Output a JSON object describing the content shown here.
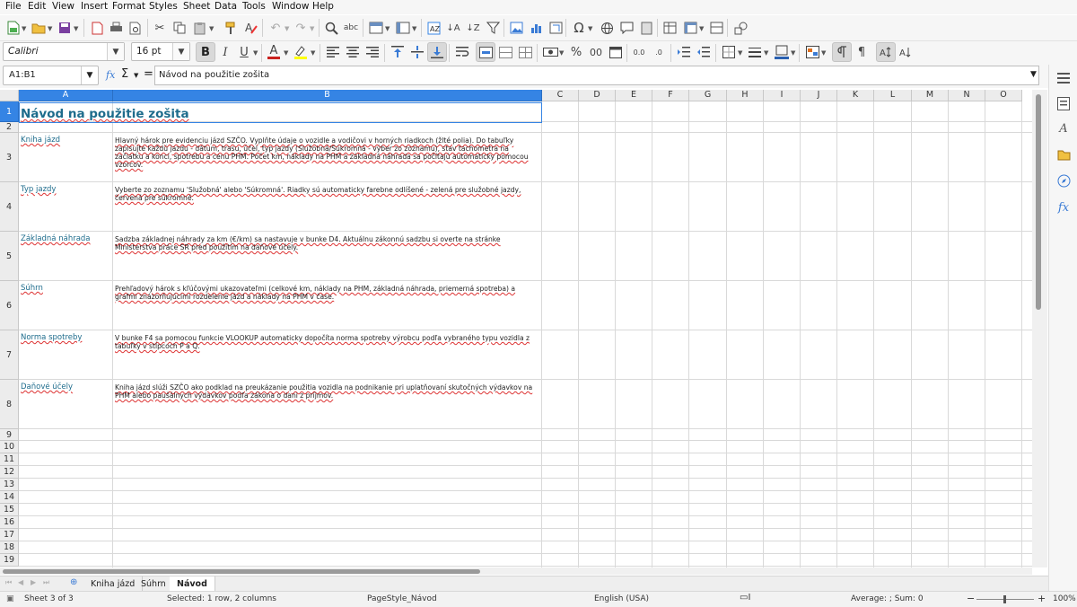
{
  "menu": [
    "File",
    "Edit",
    "View",
    "Insert",
    "Format",
    "Styles",
    "Sheet",
    "Data",
    "Tools",
    "Window",
    "Help"
  ],
  "format_bar": {
    "font_name": "Calibri",
    "font_size": "16 pt",
    "bold": "B",
    "italic": "I",
    "underline": "U",
    "font_color_glyph": "A",
    "decimal_add": "0.0",
    "decimal_del": ".0"
  },
  "formula_bar": {
    "name_box": "A1:B1",
    "fx": "fx",
    "sum": "Σ",
    "equals": "=",
    "content": "Návod na použitie zošita"
  },
  "grid": {
    "columns": [
      "A",
      "B",
      "C",
      "D",
      "E",
      "F",
      "G",
      "H",
      "I",
      "J",
      "K",
      "L",
      "M",
      "N",
      "O"
    ],
    "rows": [
      "1",
      "2",
      "3",
      "4",
      "5",
      "6",
      "7",
      "8",
      "9",
      "10",
      "11",
      "12",
      "13",
      "14",
      "15",
      "16",
      "17",
      "18",
      "19"
    ],
    "title": "Návod na použitie zošita",
    "entries": [
      {
        "label": "Kniha jázd",
        "text": "Hlavný hárok pre evidenciu jázd SZČO. Vyplňte údaje o vozidle a vodičovi v horných riadkoch (žlté polia). Do tabuľky zapisujte každú jazdu - dátum, trasu, účel, typ jazdy (Služobná/Súkromná - výber zo zoznamu), stav tachometra na začiatku a konci, spotrebu a cenu PHM. Počet km, náklady na PHM a základná náhrada sa počítajú automaticky pomocou vzorcov."
      },
      {
        "label": "Typ jazdy",
        "text": "Vyberte zo zoznamu 'Služobná' alebo 'Súkromná'. Riadky sú automaticky farebne odlíšené - zelená pre služobné jazdy, červená pre súkromné."
      },
      {
        "label": "Základná náhrada",
        "text": "Sadzba základnej náhrady za km (€/km) sa nastavuje v bunke D4. Aktuálnu zákonnú sadzbu si overte na stránke Ministerstva práce SR pred použitím na daňové účely."
      },
      {
        "label": "Súhrn",
        "text": "Prehľadový hárok s kľúčovými ukazovateľmi (celkové km, náklady na PHM, základná náhrada, priemerná spotreba) a grafmi znázorňujúcimi rozdelenie jázd a náklady na PHM v čase."
      },
      {
        "label": "Norma spotreby",
        "text": "V bunke F4 sa pomocou funkcie VLOOKUP automaticky dopočíta norma spotreby výrobcu podľa vybraného typu vozidla z tabuľky v stĺpcoch P a Q."
      },
      {
        "label": "Daňové účely",
        "text": "Kniha jázd slúži SZČO ako podklad na preukázanie použitia vozidla na podnikanie pri uplatňovaní skutočných výdavkov na PHM alebo paušálnych výdavkov podľa zákona o dani z príjmov."
      }
    ]
  },
  "sheet_tabs": [
    "Kniha jázd",
    "Súhrn",
    "Návod"
  ],
  "status": {
    "sheet": "Sheet 3 of 3",
    "selection": "Selected: 1 row, 2 columns",
    "page_style": "PageStyle_Návod",
    "language": "English (USA)",
    "summary": "Average: ; Sum: 0",
    "zoom": "100%"
  },
  "colors": {
    "accent": "#3584e4",
    "title_text": "#1e6c8c",
    "spell_underline": "#d33"
  }
}
